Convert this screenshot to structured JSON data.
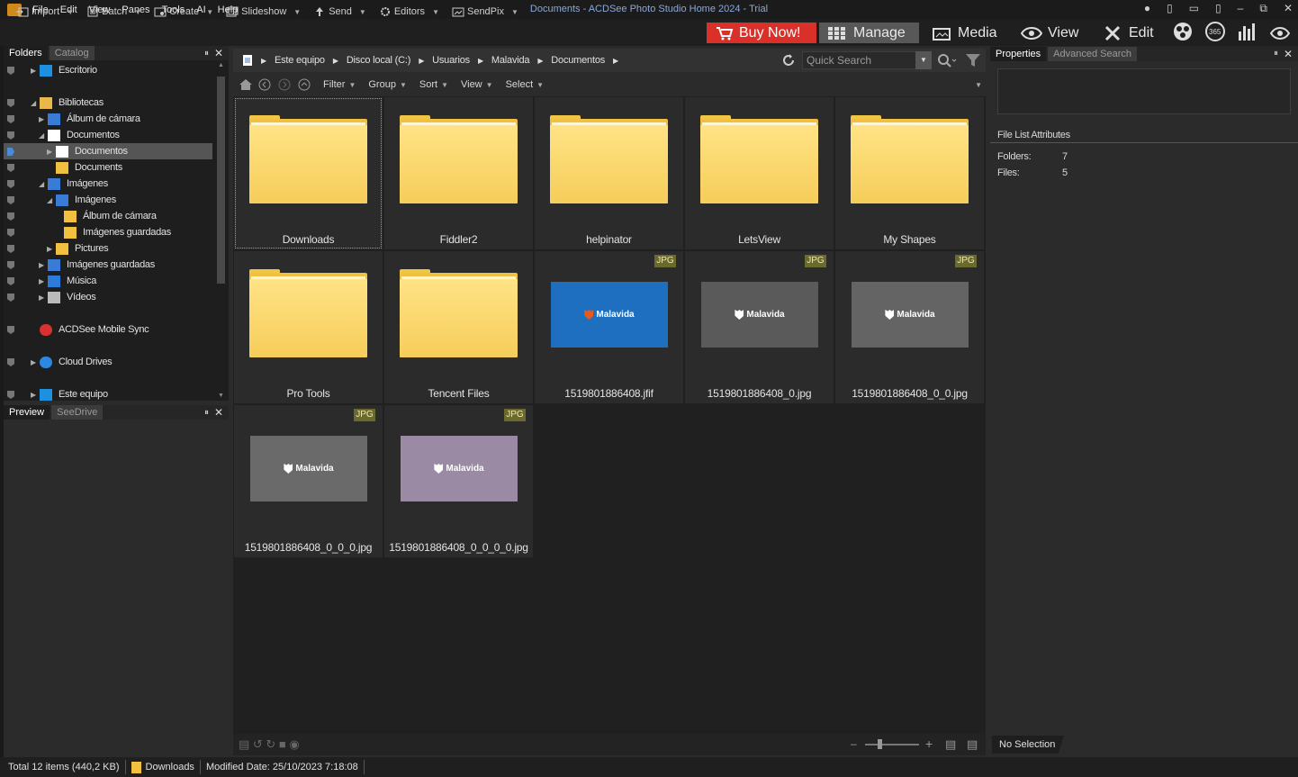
{
  "app": {
    "window_title": "Documents - ACDSee Photo Studio Home 2024 - Trial",
    "menu": [
      "File",
      "Edit",
      "View",
      "Panes",
      "Tools",
      "AI",
      "Help"
    ]
  },
  "toolbar": {
    "items": [
      {
        "label": "Import",
        "icon": "import-icon"
      },
      {
        "label": "Batch",
        "icon": "batch-icon"
      },
      {
        "label": "Create",
        "icon": "create-icon"
      },
      {
        "label": "Slideshow",
        "icon": "slideshow-icon"
      },
      {
        "label": "Send",
        "icon": "send-icon"
      },
      {
        "label": "Editors",
        "icon": "editors-icon"
      },
      {
        "label": "SendPix",
        "icon": "sendpix-icon"
      }
    ],
    "buy_now": "Buy Now!",
    "modes": {
      "manage": "Manage",
      "media": "Media",
      "view": "View",
      "edit": "Edit"
    },
    "accent": "#d9302a"
  },
  "left": {
    "tabs": {
      "folders": "Folders",
      "catalog": "Catalog"
    },
    "tree": [
      {
        "label": "Escritorio",
        "indent": 0,
        "arrow": "right"
      },
      {
        "label": "Bibliotecas",
        "indent": 0,
        "arrow": "down"
      },
      {
        "label": "Álbum de cámara",
        "indent": 1,
        "arrow": "right"
      },
      {
        "label": "Documentos",
        "indent": 1,
        "arrow": "down"
      },
      {
        "label": "Documentos",
        "indent": 2,
        "arrow": "right",
        "selected": true
      },
      {
        "label": "Documents",
        "indent": 2,
        "arrow": ""
      },
      {
        "label": "Imágenes",
        "indent": 1,
        "arrow": "down"
      },
      {
        "label": "Imágenes",
        "indent": 2,
        "arrow": "down"
      },
      {
        "label": "Álbum de cámara",
        "indent": 3,
        "arrow": ""
      },
      {
        "label": "Imágenes guardadas",
        "indent": 3,
        "arrow": ""
      },
      {
        "label": "Pictures",
        "indent": 2,
        "arrow": "right"
      },
      {
        "label": "Imágenes guardadas",
        "indent": 1,
        "arrow": "right"
      },
      {
        "label": "Música",
        "indent": 1,
        "arrow": "right"
      },
      {
        "label": "Vídeos",
        "indent": 1,
        "arrow": "right"
      },
      {
        "label": "ACDSee Mobile Sync",
        "indent": 0,
        "arrow": ""
      },
      {
        "label": "Cloud Drives",
        "indent": 0,
        "arrow": "right"
      },
      {
        "label": "Este equipo",
        "indent": 0,
        "arrow": "right"
      }
    ],
    "preview_tabs": {
      "preview": "Preview",
      "seedrive": "SeeDrive"
    }
  },
  "address": {
    "crumbs": [
      "Este equipo",
      "Disco local (C:)",
      "Usuarios",
      "Malavida",
      "Documentos"
    ],
    "search_placeholder": "Quick Search"
  },
  "filterbar": [
    "Filter",
    "Group",
    "Sort",
    "View",
    "Select"
  ],
  "items": [
    {
      "name": "Downloads",
      "type": "folder"
    },
    {
      "name": "Fiddler2",
      "type": "folder"
    },
    {
      "name": "helpinator",
      "type": "folder"
    },
    {
      "name": "LetsView",
      "type": "folder"
    },
    {
      "name": "My Shapes",
      "type": "folder"
    },
    {
      "name": "Pro Tools",
      "type": "folder"
    },
    {
      "name": "Tencent Files",
      "type": "folder"
    },
    {
      "name": "1519801886408.jfif",
      "type": "image",
      "badge": "JPG",
      "thumb_bg": "#1e6fc0",
      "thumb_text": "Malavida"
    },
    {
      "name": "1519801886408_0.jpg",
      "type": "image",
      "badge": "JPG",
      "thumb_bg": "#5a5a5a",
      "thumb_text": "Malavida"
    },
    {
      "name": "1519801886408_0_0.jpg",
      "type": "image",
      "badge": "JPG",
      "thumb_bg": "#646464",
      "thumb_text": "Malavida"
    },
    {
      "name": "1519801886408_0_0_0.jpg",
      "type": "image",
      "badge": "JPG",
      "thumb_bg": "#6a6a6a",
      "thumb_text": "Malavida"
    },
    {
      "name": "1519801886408_0_0_0_0.jpg",
      "type": "image",
      "badge": "JPG",
      "thumb_bg": "#9a8aa4",
      "thumb_text": "Malavida"
    }
  ],
  "right": {
    "tabs": {
      "properties": "Properties",
      "advanced": "Advanced Search"
    },
    "file_list_attributes": "File List Attributes",
    "folders_label": "Folders:",
    "folders_value": "7",
    "files_label": "Files:",
    "files_value": "5",
    "no_selection": "No Selection"
  },
  "status": {
    "total": "Total 12 items  (440,2 KB)",
    "current": "Downloads",
    "modified": "Modified Date: 25/10/2023 7:18:08"
  }
}
